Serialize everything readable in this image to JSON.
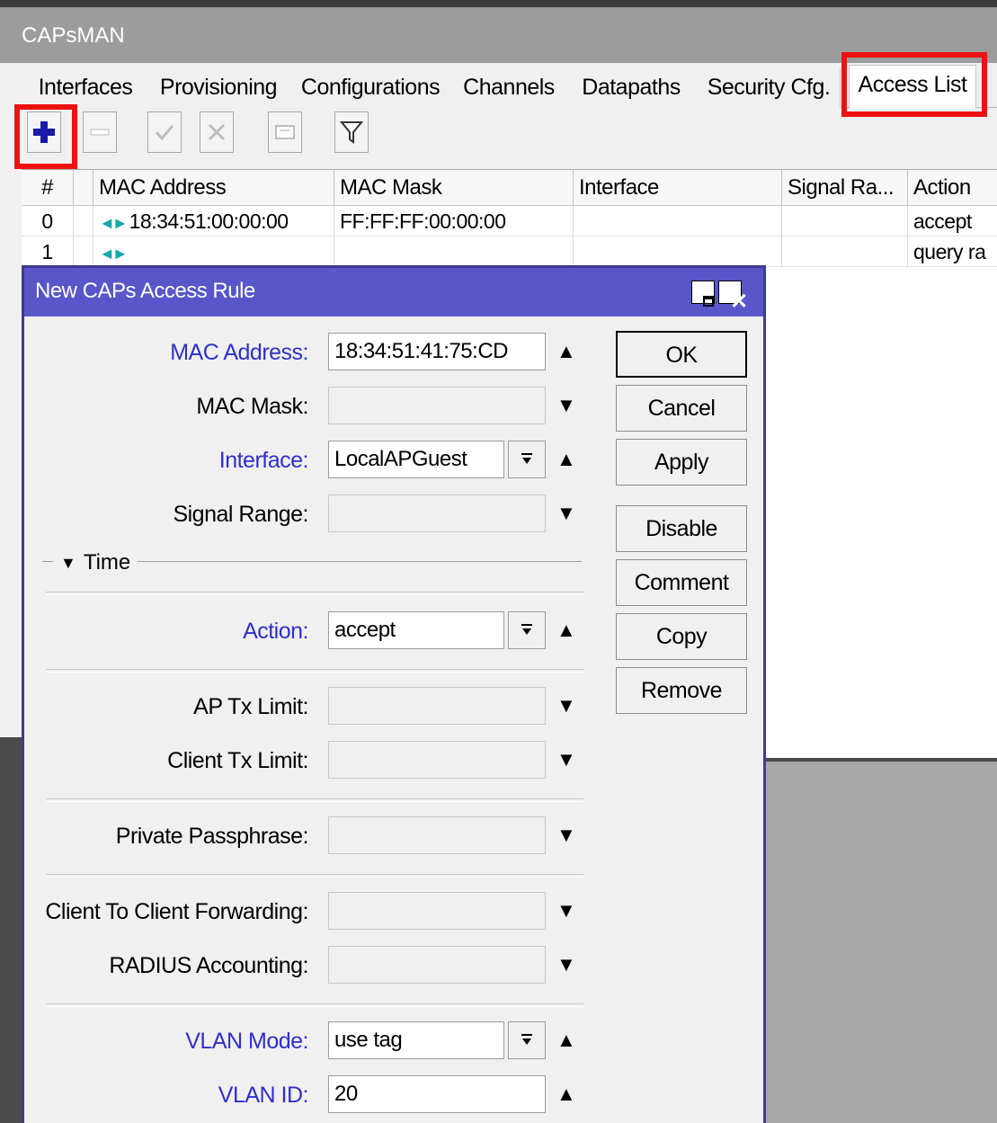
{
  "window": {
    "title": "CAPsMAN",
    "tabs": [
      "Interfaces",
      "Provisioning",
      "Configurations",
      "Channels",
      "Datapaths",
      "Security Cfg.",
      "Access List"
    ],
    "active_tab": "Access List"
  },
  "toolbar": {
    "add_icon": "plus-icon",
    "remove_icon": "minus-icon",
    "enable_icon": "check-icon",
    "disable_icon": "cross-icon",
    "comment_icon": "note-icon",
    "filter_icon": "filter-icon"
  },
  "table": {
    "columns": [
      "#",
      "MAC Address",
      "MAC Mask",
      "Interface",
      "Signal Ra...",
      "Action"
    ],
    "rows": [
      {
        "num": "0",
        "mac": "18:34:51:00:00:00",
        "mask": "FF:FF:FF:00:00:00",
        "interface": "",
        "signal": "",
        "action": "accept"
      },
      {
        "num": "1",
        "mac": "",
        "mask": "",
        "interface": "",
        "signal": "",
        "action": "query ra"
      }
    ]
  },
  "dialog": {
    "title": "New CAPs Access Rule",
    "fields": {
      "mac_address": {
        "label": "MAC Address:",
        "value": "18:34:51:41:75:CD"
      },
      "mac_mask": {
        "label": "MAC Mask:",
        "value": ""
      },
      "interface": {
        "label": "Interface:",
        "value": "LocalAPGuest"
      },
      "signal_range": {
        "label": "Signal Range:",
        "value": ""
      },
      "time_section": "Time",
      "action": {
        "label": "Action:",
        "value": "accept"
      },
      "ap_tx_limit": {
        "label": "AP Tx Limit:",
        "value": ""
      },
      "client_tx_limit": {
        "label": "Client Tx Limit:",
        "value": ""
      },
      "private_passphrase": {
        "label": "Private Passphrase:",
        "value": ""
      },
      "client_to_client": {
        "label": "Client To Client Forwarding:",
        "value": ""
      },
      "radius_accounting": {
        "label": "RADIUS Accounting:",
        "value": ""
      },
      "vlan_mode": {
        "label": "VLAN Mode:",
        "value": "use tag"
      },
      "vlan_id": {
        "label": "VLAN ID:",
        "value": "20"
      }
    },
    "buttons": {
      "ok": "OK",
      "cancel": "Cancel",
      "apply": "Apply",
      "disable": "Disable",
      "comment": "Comment",
      "copy": "Copy",
      "remove": "Remove"
    }
  },
  "colors": {
    "highlight": "#ee1111",
    "title_bar": "#5856c8",
    "blue_label": "#2f2fcc"
  }
}
